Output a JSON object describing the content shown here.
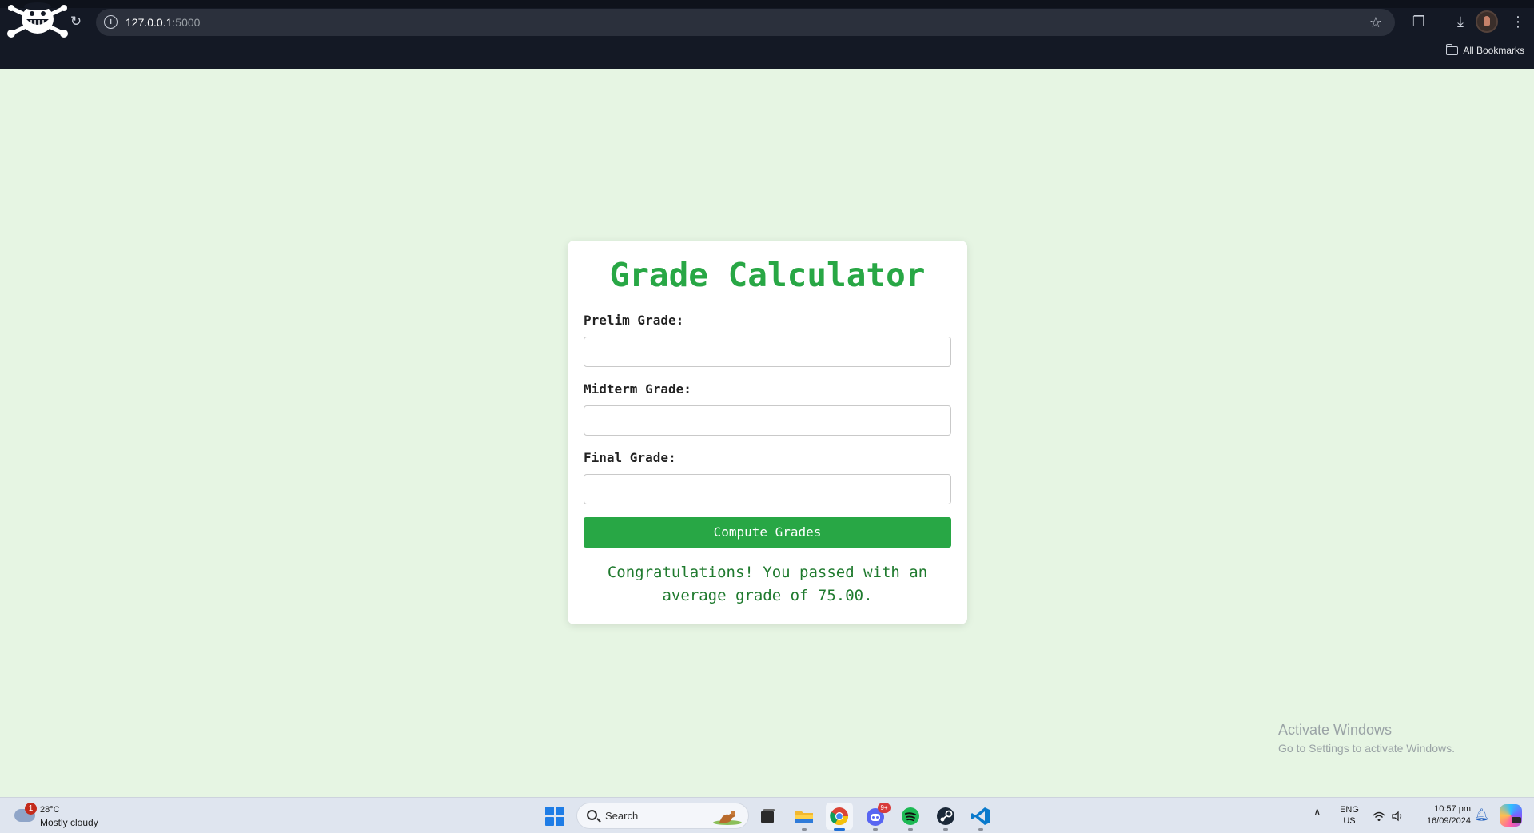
{
  "browser": {
    "url_host": "127.0.0.1",
    "url_port": ":5000",
    "bookmarks_label": "All Bookmarks"
  },
  "form": {
    "title": "Grade Calculator",
    "prelim_label": "Prelim Grade:",
    "prelim_value": "",
    "midterm_label": "Midterm Grade:",
    "midterm_value": "",
    "final_label": "Final Grade:",
    "final_value": "",
    "compute_label": "Compute Grades",
    "result_text": "Congratulations! You passed with an average grade of 75.00."
  },
  "watermark": {
    "title": "Activate Windows",
    "subtitle": "Go to Settings to activate Windows."
  },
  "taskbar": {
    "weather_badge": "1",
    "weather_temp": "28°C",
    "weather_desc": "Mostly cloudy",
    "search_placeholder": "Search",
    "discord_badge": "9+",
    "lang_top": "ENG",
    "lang_bottom": "US",
    "time": "10:57 pm",
    "date": "16/09/2024"
  },
  "colors": {
    "accent": "#28a745",
    "page_background": "#e6f5e3",
    "result_text": "#1f7a2e",
    "chrome": "#141925"
  }
}
